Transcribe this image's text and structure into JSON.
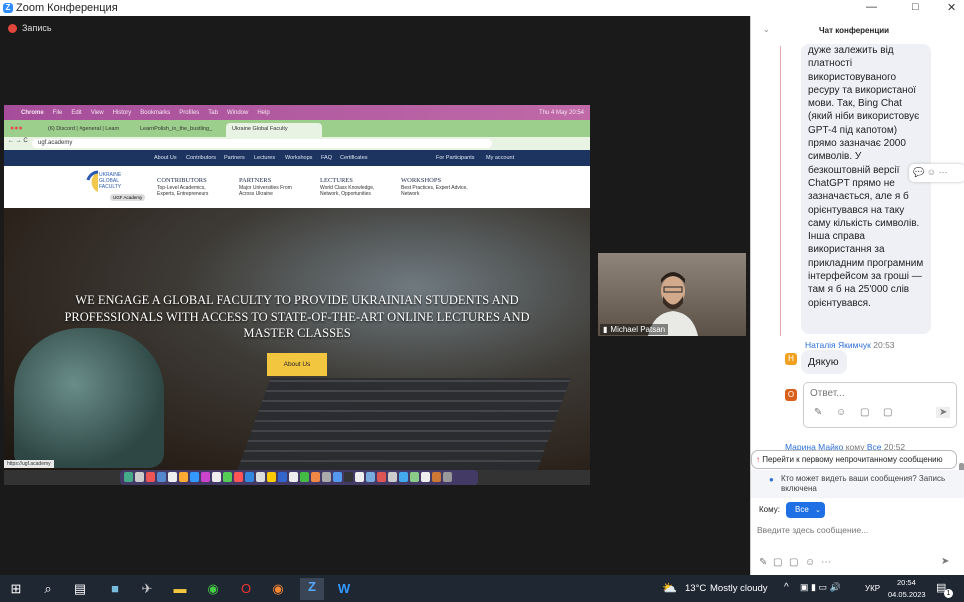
{
  "window": {
    "title": "Zoom Конференция",
    "minimize": "—",
    "maximize": "□",
    "close": "✕"
  },
  "recording": {
    "label": "Запись"
  },
  "shared_screen": {
    "menubar": {
      "items": [
        "Chrome",
        "File",
        "Edit",
        "View",
        "History",
        "Bookmarks",
        "Profiles",
        "Tab",
        "Window",
        "Help"
      ],
      "clock": "Thu 4 May 20:54"
    },
    "tabs": [
      {
        "label": "(6) Discord | #general | Learn"
      },
      {
        "label": "LearnPolish_in_the_bustling_"
      },
      {
        "label": "Ukraine Global Faculty"
      }
    ],
    "url": "ugf.academy",
    "site_nav": {
      "items": [
        "About Us",
        "Contributors",
        "Partners",
        "Lectures",
        "Workshops",
        "FAQ",
        "Certificates"
      ],
      "participants": "For Participants",
      "account": "My account"
    },
    "logo": {
      "line1": "UKRAINE",
      "line2": "GLOBAL",
      "line3": "FACULTY",
      "dropdown": "UGF Academy"
    },
    "columns": [
      {
        "title": "CONTRIBUTORS",
        "desc1": "Top-Level Academics,",
        "desc2": "Experts, Entrepreneurs"
      },
      {
        "title": "PARTNERS",
        "desc1": "Major Universities From",
        "desc2": "Across Ukraine"
      },
      {
        "title": "LECTURES",
        "desc1": "World Class Knowledge,",
        "desc2": "Network, Opportunities"
      },
      {
        "title": "WORKSHOPS",
        "desc1": "Best Practices, Expert Advice,",
        "desc2": "Network"
      }
    ],
    "hero": {
      "headline": "We engage a global faculty to provide Ukrainian students and professionals with access to state-of-the-art online lectures and master classes",
      "button": "About Us"
    },
    "status_url": "https://ugf.academy"
  },
  "video": {
    "name": "Michael Patsan"
  },
  "chat": {
    "title": "Чат конференции",
    "message1": "дуже залежить від платності використовуваного ресуру та використаної мови. Так, Bing Chat (який ніби використовує GPT-4 під капотом) прямо зазначає 2000 символів. У безкоштовній версії ChatGPT прямо не зазначається, але я б орієнтувався на таку саму кількість символів. Інша справа використання за прикладним програмним інтерфейсом за гроші — там я б на 25'000 слів орієнтувався.",
    "message2": {
      "sender": "Наталія Якимчук",
      "time": "20:53",
      "avatar": "Н",
      "text": "Дякую"
    },
    "reply": {
      "avatar": "О",
      "placeholder": "Ответ..."
    },
    "message3": {
      "sender": "Марина Майко",
      "to_word": "кому",
      "to": "Все",
      "time": "20:52"
    },
    "jump_unread": "Перейти к первому непрочитанному сообщению",
    "visibility": "Кто может видеть ваши сообщения? Запись включена",
    "to_label": "Кому:",
    "to_value": "Все",
    "input_placeholder": "Введите здесь сообщение...",
    "colors": {
      "accent": "#1f6fe5",
      "avatar_h": "#f0a020",
      "avatar_o": "#d9601a"
    }
  },
  "taskbar": {
    "weather_temp": "13°C",
    "weather_text": "Mostly cloudy",
    "lang": "УКР",
    "time": "20:54",
    "date": "04.05.2023",
    "notifications": "1"
  }
}
